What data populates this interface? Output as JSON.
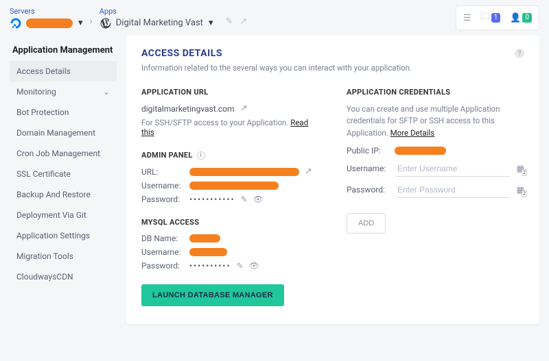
{
  "breadcrumb": {
    "servers_label": "Servers",
    "apps_label": "Apps",
    "app_name": "Digital Marketing Vast"
  },
  "top_actions": {
    "folder_badge": "1",
    "user_badge": "0"
  },
  "sidebar": {
    "title": "Application Management",
    "items": [
      {
        "label": "Access Details",
        "active": true
      },
      {
        "label": "Monitoring",
        "expandable": true
      },
      {
        "label": "Bot Protection"
      },
      {
        "label": "Domain Management"
      },
      {
        "label": "Cron Job Management"
      },
      {
        "label": "SSL Certificate"
      },
      {
        "label": "Backup And Restore"
      },
      {
        "label": "Deployment Via Git"
      },
      {
        "label": "Application Settings"
      },
      {
        "label": "Migration Tools"
      },
      {
        "label": "CloudwaysCDN"
      }
    ]
  },
  "page": {
    "title": "ACCESS DETAILS",
    "subtitle": "Information related to the several ways you can interact with your application."
  },
  "app_url": {
    "heading": "APPLICATION URL",
    "url": "digitalmarketingvast.com",
    "note_prefix": "For SSH/SFTP access to your Application. ",
    "note_link": "Read this"
  },
  "admin_panel": {
    "heading": "ADMIN PANEL",
    "url_label": "URL:",
    "username_label": "Username:",
    "password_label": "Password:",
    "password_mask": "•••••••••••"
  },
  "mysql": {
    "heading": "MYSQL ACCESS",
    "dbname_label": "DB Name:",
    "username_label": "Username:",
    "password_label": "Password:",
    "password_mask": "••••••••••",
    "button": "LAUNCH DATABASE MANAGER"
  },
  "credentials": {
    "heading": "APPLICATION CREDENTIALS",
    "description": "You can create and use multiple Application credentials for SFTP or SSH access to this Application. ",
    "more_link": "More Details",
    "public_ip_label": "Public IP:",
    "username_label": "Username:",
    "username_placeholder": "Enter Username",
    "password_label": "Password:",
    "password_placeholder": "Enter Password",
    "add_button": "ADD"
  }
}
